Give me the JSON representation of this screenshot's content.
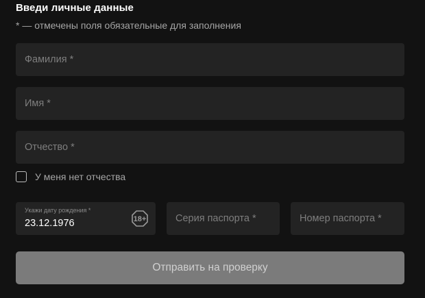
{
  "form": {
    "title": "Введи личные данные",
    "required_note": "* — отмечены поля обязательные для заполнения",
    "last_name": {
      "placeholder": "Фамилия *",
      "value": ""
    },
    "first_name": {
      "placeholder": "Имя *",
      "value": ""
    },
    "patronymic": {
      "placeholder": "Отчество *",
      "value": ""
    },
    "no_patronymic": {
      "label": "У меня нет отчества",
      "checked": false
    },
    "birth_date": {
      "label": "Укажи дату рождения *",
      "value": "23.12.1976",
      "badge": "18+"
    },
    "passport_series": {
      "placeholder": "Серия паспорта *",
      "value": ""
    },
    "passport_number": {
      "placeholder": "Номер паспорта *",
      "value": ""
    },
    "submit_label": "Отправить на проверку"
  },
  "colors": {
    "background": "#121212",
    "field_bg": "#232323",
    "button_bg": "#7b7b7b",
    "text_white": "#ffffff",
    "text_muted": "#7e7e7e"
  }
}
